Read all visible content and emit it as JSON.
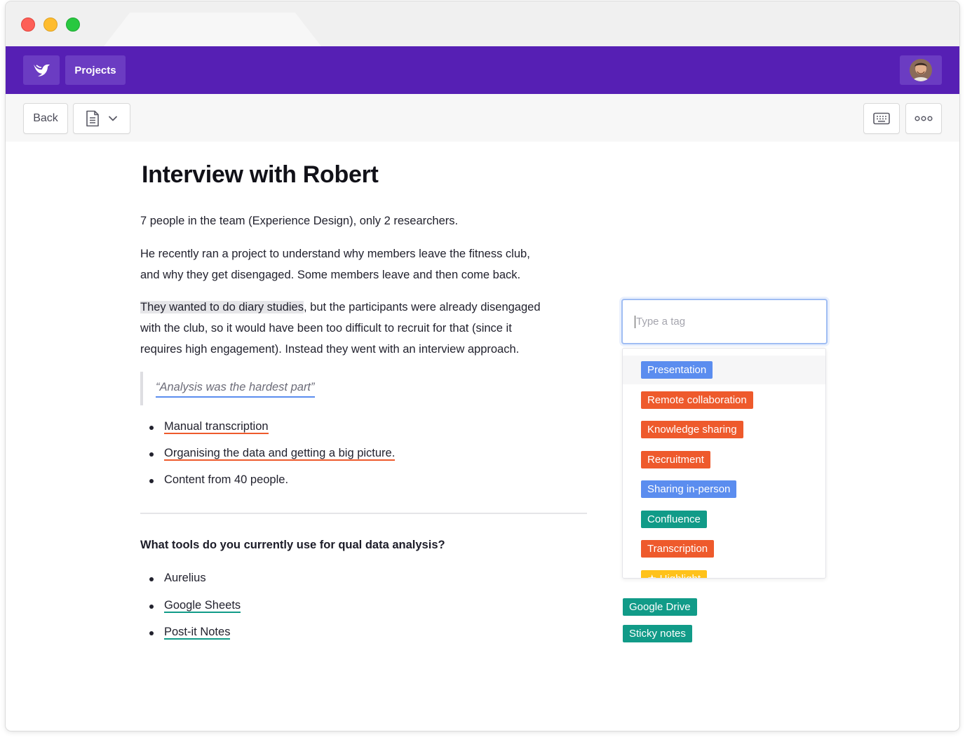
{
  "header": {
    "projects_label": "Projects"
  },
  "toolbar": {
    "back_label": "Back"
  },
  "document": {
    "title": "Interview with Robert",
    "paragraph1": "7 people in the team (Experience Design), only 2 researchers.",
    "paragraph2_line1": "He recently ran a project to understand why members leave the fitness club,",
    "paragraph2_line2": "and why they get disengaged. Some members leave and then come back.",
    "paragraph3_highlight": "They wanted to do diary studies",
    "paragraph3_rest": ", but the participants were already disengaged",
    "paragraph3_line2": "with the club, so it would have been too difficult to recruit for that (since it",
    "paragraph3_line3": "requires high engagement). Instead they went with an interview approach.",
    "quote": "“Analysis was the hardest part”",
    "bullets": [
      "Manual transcription",
      "Organising the data and getting a big picture.",
      "Content from 40 people."
    ],
    "question": "What tools do you currently use for qual data analysis?",
    "tools": [
      "Aurelius",
      "Google Sheets",
      "Post-it Notes"
    ]
  },
  "tag_picker": {
    "placeholder": "Type a tag",
    "options": [
      {
        "label": "Presentation",
        "color": "#5b8def"
      },
      {
        "label": "Remote collaboration",
        "color": "#ee5a2c"
      },
      {
        "label": "Knowledge sharing",
        "color": "#ee5a2c"
      },
      {
        "label": "Recruitment",
        "color": "#ee5a2c"
      },
      {
        "label": "Sharing in-person",
        "color": "#5b8def"
      },
      {
        "label": "Confluence",
        "color": "#119b88"
      },
      {
        "label": "Transcription",
        "color": "#ee5a2c"
      },
      {
        "label": "Highlight",
        "color": "#ffc21a"
      }
    ]
  },
  "applied_tags": [
    {
      "label": "Google Drive",
      "color": "#119b88"
    },
    {
      "label": "Sticky notes",
      "color": "#119b88"
    }
  ],
  "colors": {
    "brand": "#561fb4",
    "brand_light": "#6b3cc2"
  }
}
